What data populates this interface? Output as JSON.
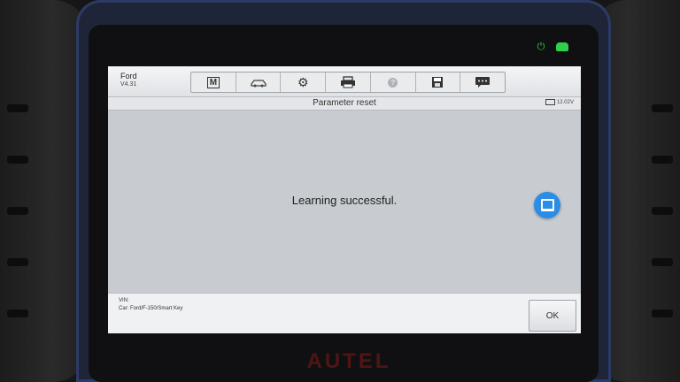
{
  "header": {
    "make": "Ford",
    "version": "V4.31"
  },
  "toolbar": {
    "icons": [
      "home-icon",
      "vehicle-swap-icon",
      "settings-icon",
      "print-icon",
      "help-icon",
      "save-icon",
      "feedback-icon"
    ],
    "home_glyph": "M",
    "settings_glyph": "⚙",
    "help_glyph": "?"
  },
  "titlebar": {
    "title": "Parameter reset",
    "battery": "12.02V"
  },
  "main": {
    "message": "Learning successful."
  },
  "footer": {
    "vin_label": "VIN:",
    "car": "Car: Ford/F-150/Smart Key",
    "ok_label": "OK"
  },
  "device": {
    "brand": "AUTEL"
  }
}
